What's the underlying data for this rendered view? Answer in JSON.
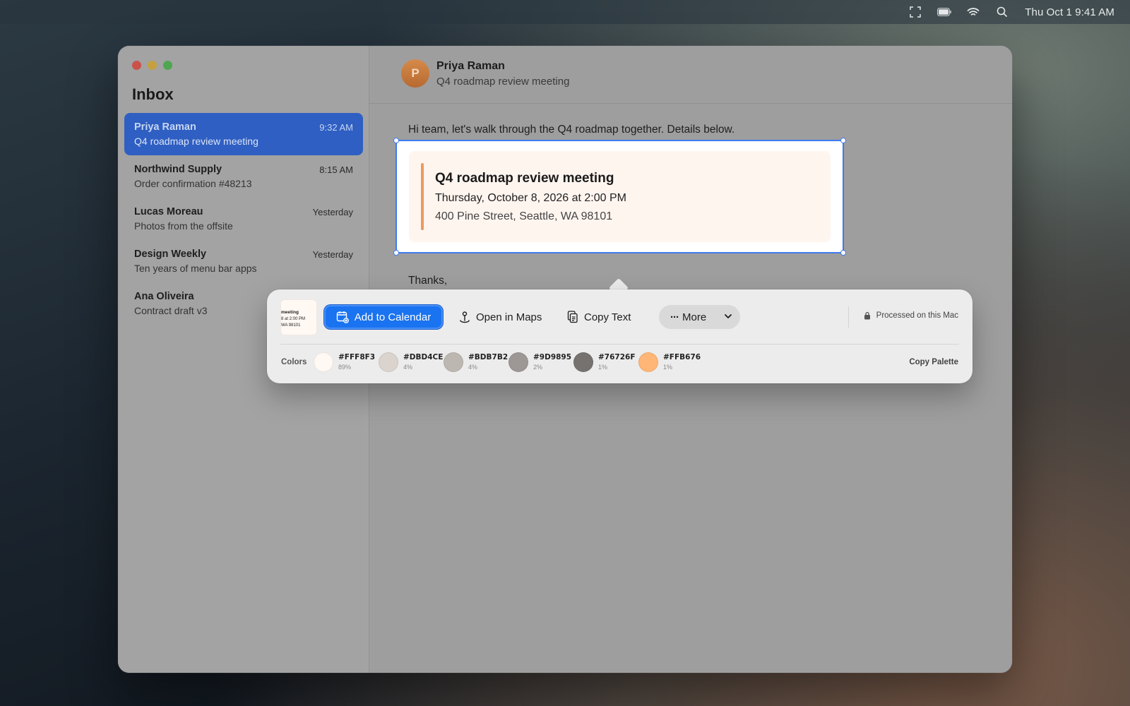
{
  "menubar": {
    "icons": [
      "fullscreen-icon",
      "battery-icon",
      "wifi-icon",
      "search-icon"
    ],
    "clock": "Thu Oct 1  9:41 AM"
  },
  "sidebar": {
    "title": "Inbox",
    "messages": [
      {
        "sender": "Priya Raman",
        "subject": "Q4 roadmap review meeting",
        "time": "9:32 AM",
        "selected": true
      },
      {
        "sender": "Northwind Supply",
        "subject": "Order confirmation #48213",
        "time": "8:15 AM"
      },
      {
        "sender": "Lucas Moreau",
        "subject": "Photos from the offsite",
        "time": "Yesterday"
      },
      {
        "sender": "Design Weekly",
        "subject": "Ten years of menu bar apps",
        "time": "Yesterday"
      },
      {
        "sender": "Ana Oliveira",
        "subject": "Contract draft v3",
        "time": ""
      }
    ]
  },
  "message": {
    "avatar_initial": "P",
    "sender": "Priya Raman",
    "subject": "Q4 roadmap review meeting",
    "greeting": "Hi team, let's walk through the Q4 roadmap together. Details below.",
    "closing": "Thanks,",
    "event": {
      "title": "Q4 roadmap review meeting",
      "when": "Thursday, October 8, 2026 at 2:00 PM",
      "where": "400 Pine Street, Seattle, WA 98101"
    }
  },
  "popover": {
    "thumbnail_lines": [
      "meeting",
      "8 at 2:00 PM",
      "WA 98101"
    ],
    "actions": {
      "add_calendar": "Add to Calendar",
      "open_maps": "Open in Maps",
      "copy_text": "Copy Text",
      "more": "More"
    },
    "processed": "Processed on this Mac",
    "colors_label": "Colors",
    "copy_palette": "Copy Palette",
    "palette": [
      {
        "hex": "#FFF8F3",
        "pct": "89%"
      },
      {
        "hex": "#DBD4CE",
        "pct": "4%"
      },
      {
        "hex": "#BDB7B2",
        "pct": "4%"
      },
      {
        "hex": "#9D9895",
        "pct": "2%"
      },
      {
        "hex": "#76726F",
        "pct": "1%"
      },
      {
        "hex": "#FFB676",
        "pct": "1%"
      }
    ]
  },
  "colors": {
    "accent": "#1A73F0",
    "selection": "#3E7BF0",
    "event_bar": "#EB9A5E"
  }
}
